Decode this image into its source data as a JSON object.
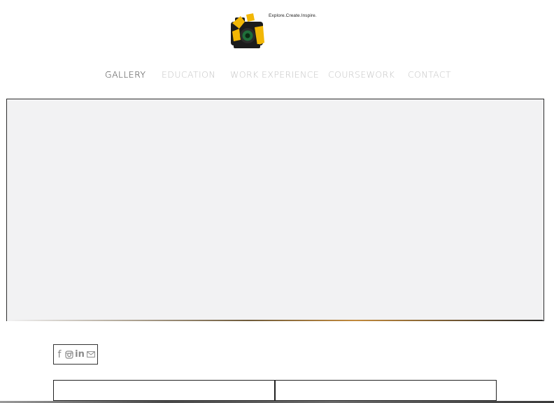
{
  "site": {
    "tagline": "Explore.Create.Inspire."
  },
  "nav": {
    "items": [
      {
        "label": "GALLERY",
        "active": true
      },
      {
        "label": "EDUCATION",
        "active": false
      },
      {
        "label": "WORK EXPERIENCE",
        "active": false
      },
      {
        "label": "COURSEWORK",
        "active": false
      },
      {
        "label": "CONTACT",
        "active": false
      }
    ]
  },
  "social": {
    "icons": [
      "facebook-icon",
      "instagram-icon",
      "linkedin-icon",
      "email-icon"
    ],
    "facebook_glyph": "f",
    "linkedin_glyph": "in"
  },
  "colors": {
    "nav_active": "#3a3a3a",
    "nav_inactive": "#c4c4c4",
    "gallery_bg": "#f2f2f3",
    "logo_yellow": "#f2b705",
    "icon_gray": "#8a8a8a"
  }
}
